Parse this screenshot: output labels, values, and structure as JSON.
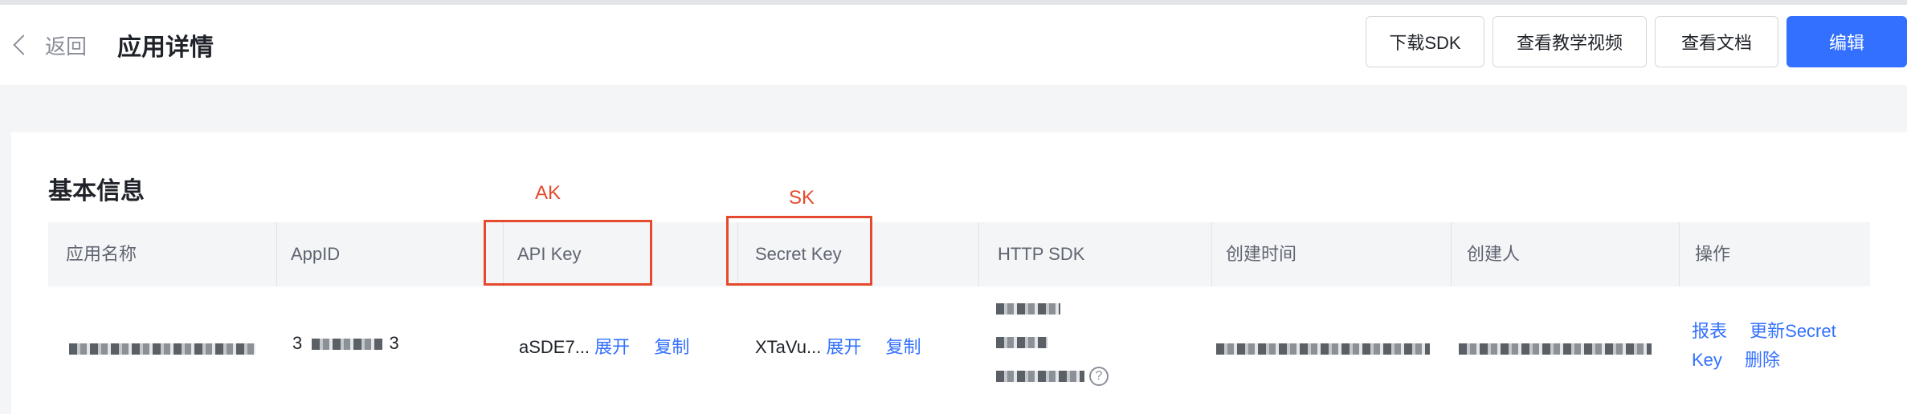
{
  "header": {
    "back_label": "返回",
    "title": "应用详情",
    "actions": {
      "download_sdk": "下载SDK",
      "tutorial_video": "查看教学视频",
      "docs": "查看文档",
      "edit": "编辑"
    }
  },
  "section": {
    "title": "基本信息"
  },
  "annotations": {
    "ak": "AK",
    "sk": "SK",
    "color": "#e64a2e"
  },
  "table": {
    "headers": [
      "应用名称",
      "AppID",
      "API Key",
      "Secret Key",
      "HTTP SDK",
      "创建时间",
      "创建人",
      "操作"
    ],
    "row": {
      "app_id_start": "3",
      "app_id_end": "3",
      "api_key": "aSDE7...",
      "secret_key": "XTaVu...",
      "expand_label": "展开",
      "copy_label": "复制",
      "help_icon": "?",
      "ops": {
        "report": "报表",
        "update_secret_line1": "更新Secret",
        "update_secret_line2": "Key",
        "delete": "删除"
      }
    }
  },
  "colors": {
    "primary": "#3370ff",
    "header_bg": "#f4f5f7",
    "accent_annotation": "#e64a2e"
  }
}
